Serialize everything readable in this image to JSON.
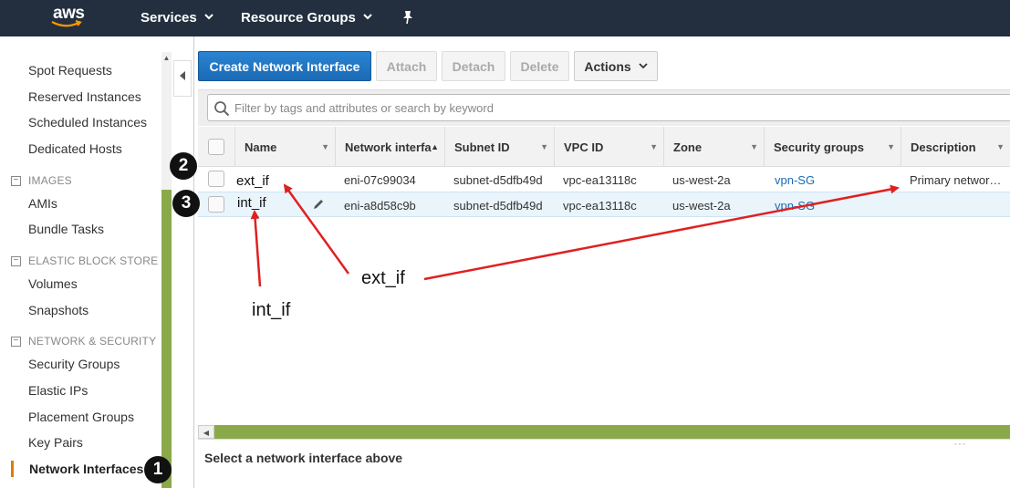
{
  "topnav": {
    "logo": "aws",
    "services": "Services",
    "resource_groups": "Resource Groups"
  },
  "sidebar": {
    "items_top": [
      "Spot Requests",
      "Reserved Instances",
      "Scheduled Instances",
      "Dedicated Hosts"
    ],
    "images_header": "IMAGES",
    "images_items": [
      "AMIs",
      "Bundle Tasks"
    ],
    "ebs_header": "ELASTIC BLOCK STORE",
    "ebs_items": [
      "Volumes",
      "Snapshots"
    ],
    "net_header": "NETWORK & SECURITY",
    "net_items": [
      "Security Groups",
      "Elastic IPs",
      "Placement Groups",
      "Key Pairs",
      "Network Interfaces"
    ]
  },
  "toolbar": {
    "create": "Create Network Interface",
    "attach": "Attach",
    "detach": "Detach",
    "delete": "Delete",
    "actions": "Actions"
  },
  "filter": {
    "placeholder": "Filter by tags and attributes or search by keyword"
  },
  "table": {
    "columns": [
      "Name",
      "Network interfa",
      "Subnet ID",
      "VPC ID",
      "Zone",
      "Security groups",
      "Description"
    ],
    "rows": [
      {
        "name": "ext_if",
        "eni": "eni-07c99034",
        "subnet": "subnet-d5dfb49d",
        "vpc": "vpc-ea13118c",
        "zone": "us-west-2a",
        "sg": "vpn-SG",
        "desc": "Primary networ…"
      },
      {
        "name": "int_if",
        "eni": "eni-a8d58c9b",
        "subnet": "subnet-d5dfb49d",
        "vpc": "vpc-ea13118c",
        "zone": "us-west-2a",
        "sg": "vpn-SG",
        "desc": ""
      }
    ]
  },
  "detail": {
    "message": "Select a network interface above"
  },
  "annotations": {
    "step1": "1",
    "step2": "2",
    "step3": "3",
    "label_ext": "ext_if",
    "label_int": "int_if",
    "arrow_color": "#e02020"
  }
}
